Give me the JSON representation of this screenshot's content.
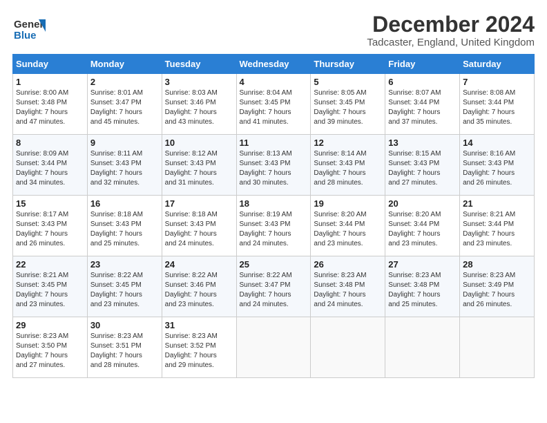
{
  "header": {
    "logo_line1": "General",
    "logo_line2": "Blue",
    "month_title": "December 2024",
    "location": "Tadcaster, England, United Kingdom"
  },
  "weekdays": [
    "Sunday",
    "Monday",
    "Tuesday",
    "Wednesday",
    "Thursday",
    "Friday",
    "Saturday"
  ],
  "weeks": [
    [
      {
        "day": "1",
        "info": "Sunrise: 8:00 AM\nSunset: 3:48 PM\nDaylight: 7 hours\nand 47 minutes."
      },
      {
        "day": "2",
        "info": "Sunrise: 8:01 AM\nSunset: 3:47 PM\nDaylight: 7 hours\nand 45 minutes."
      },
      {
        "day": "3",
        "info": "Sunrise: 8:03 AM\nSunset: 3:46 PM\nDaylight: 7 hours\nand 43 minutes."
      },
      {
        "day": "4",
        "info": "Sunrise: 8:04 AM\nSunset: 3:45 PM\nDaylight: 7 hours\nand 41 minutes."
      },
      {
        "day": "5",
        "info": "Sunrise: 8:05 AM\nSunset: 3:45 PM\nDaylight: 7 hours\nand 39 minutes."
      },
      {
        "day": "6",
        "info": "Sunrise: 8:07 AM\nSunset: 3:44 PM\nDaylight: 7 hours\nand 37 minutes."
      },
      {
        "day": "7",
        "info": "Sunrise: 8:08 AM\nSunset: 3:44 PM\nDaylight: 7 hours\nand 35 minutes."
      }
    ],
    [
      {
        "day": "8",
        "info": "Sunrise: 8:09 AM\nSunset: 3:44 PM\nDaylight: 7 hours\nand 34 minutes."
      },
      {
        "day": "9",
        "info": "Sunrise: 8:11 AM\nSunset: 3:43 PM\nDaylight: 7 hours\nand 32 minutes."
      },
      {
        "day": "10",
        "info": "Sunrise: 8:12 AM\nSunset: 3:43 PM\nDaylight: 7 hours\nand 31 minutes."
      },
      {
        "day": "11",
        "info": "Sunrise: 8:13 AM\nSunset: 3:43 PM\nDaylight: 7 hours\nand 30 minutes."
      },
      {
        "day": "12",
        "info": "Sunrise: 8:14 AM\nSunset: 3:43 PM\nDaylight: 7 hours\nand 28 minutes."
      },
      {
        "day": "13",
        "info": "Sunrise: 8:15 AM\nSunset: 3:43 PM\nDaylight: 7 hours\nand 27 minutes."
      },
      {
        "day": "14",
        "info": "Sunrise: 8:16 AM\nSunset: 3:43 PM\nDaylight: 7 hours\nand 26 minutes."
      }
    ],
    [
      {
        "day": "15",
        "info": "Sunrise: 8:17 AM\nSunset: 3:43 PM\nDaylight: 7 hours\nand 26 minutes."
      },
      {
        "day": "16",
        "info": "Sunrise: 8:18 AM\nSunset: 3:43 PM\nDaylight: 7 hours\nand 25 minutes."
      },
      {
        "day": "17",
        "info": "Sunrise: 8:18 AM\nSunset: 3:43 PM\nDaylight: 7 hours\nand 24 minutes."
      },
      {
        "day": "18",
        "info": "Sunrise: 8:19 AM\nSunset: 3:43 PM\nDaylight: 7 hours\nand 24 minutes."
      },
      {
        "day": "19",
        "info": "Sunrise: 8:20 AM\nSunset: 3:44 PM\nDaylight: 7 hours\nand 23 minutes."
      },
      {
        "day": "20",
        "info": "Sunrise: 8:20 AM\nSunset: 3:44 PM\nDaylight: 7 hours\nand 23 minutes."
      },
      {
        "day": "21",
        "info": "Sunrise: 8:21 AM\nSunset: 3:44 PM\nDaylight: 7 hours\nand 23 minutes."
      }
    ],
    [
      {
        "day": "22",
        "info": "Sunrise: 8:21 AM\nSunset: 3:45 PM\nDaylight: 7 hours\nand 23 minutes."
      },
      {
        "day": "23",
        "info": "Sunrise: 8:22 AM\nSunset: 3:45 PM\nDaylight: 7 hours\nand 23 minutes."
      },
      {
        "day": "24",
        "info": "Sunrise: 8:22 AM\nSunset: 3:46 PM\nDaylight: 7 hours\nand 23 minutes."
      },
      {
        "day": "25",
        "info": "Sunrise: 8:22 AM\nSunset: 3:47 PM\nDaylight: 7 hours\nand 24 minutes."
      },
      {
        "day": "26",
        "info": "Sunrise: 8:23 AM\nSunset: 3:48 PM\nDaylight: 7 hours\nand 24 minutes."
      },
      {
        "day": "27",
        "info": "Sunrise: 8:23 AM\nSunset: 3:48 PM\nDaylight: 7 hours\nand 25 minutes."
      },
      {
        "day": "28",
        "info": "Sunrise: 8:23 AM\nSunset: 3:49 PM\nDaylight: 7 hours\nand 26 minutes."
      }
    ],
    [
      {
        "day": "29",
        "info": "Sunrise: 8:23 AM\nSunset: 3:50 PM\nDaylight: 7 hours\nand 27 minutes."
      },
      {
        "day": "30",
        "info": "Sunrise: 8:23 AM\nSunset: 3:51 PM\nDaylight: 7 hours\nand 28 minutes."
      },
      {
        "day": "31",
        "info": "Sunrise: 8:23 AM\nSunset: 3:52 PM\nDaylight: 7 hours\nand 29 minutes."
      },
      null,
      null,
      null,
      null
    ]
  ]
}
